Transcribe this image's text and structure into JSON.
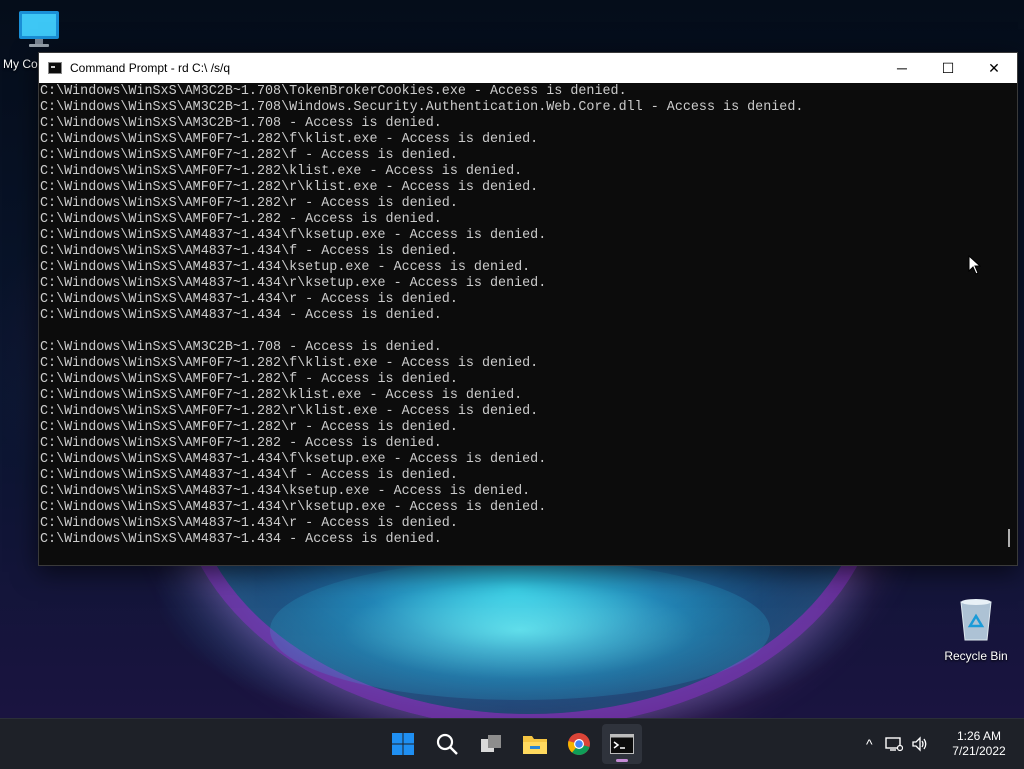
{
  "desktop": {
    "icons": [
      {
        "label": "My Computer"
      },
      {
        "label": "Recycle Bin"
      }
    ]
  },
  "window": {
    "title": "Command Prompt - rd  C:\\ /s/q",
    "controls": {
      "minimize": "─",
      "maximize": "☐",
      "close": "✕"
    }
  },
  "console": {
    "lines": [
      "C:\\Windows\\WinSxS\\AM3C2B~1.708\\TokenBrokerCookies.exe - Access is denied.",
      "C:\\Windows\\WinSxS\\AM3C2B~1.708\\Windows.Security.Authentication.Web.Core.dll - Access is denied.",
      "C:\\Windows\\WinSxS\\AM3C2B~1.708 - Access is denied.",
      "C:\\Windows\\WinSxS\\AMF0F7~1.282\\f\\klist.exe - Access is denied.",
      "C:\\Windows\\WinSxS\\AMF0F7~1.282\\f - Access is denied.",
      "C:\\Windows\\WinSxS\\AMF0F7~1.282\\klist.exe - Access is denied.",
      "C:\\Windows\\WinSxS\\AMF0F7~1.282\\r\\klist.exe - Access is denied.",
      "C:\\Windows\\WinSxS\\AMF0F7~1.282\\r - Access is denied.",
      "C:\\Windows\\WinSxS\\AMF0F7~1.282 - Access is denied.",
      "C:\\Windows\\WinSxS\\AM4837~1.434\\f\\ksetup.exe - Access is denied.",
      "C:\\Windows\\WinSxS\\AM4837~1.434\\f - Access is denied.",
      "C:\\Windows\\WinSxS\\AM4837~1.434\\ksetup.exe - Access is denied.",
      "C:\\Windows\\WinSxS\\AM4837~1.434\\r\\ksetup.exe - Access is denied.",
      "C:\\Windows\\WinSxS\\AM4837~1.434\\r - Access is denied.",
      "C:\\Windows\\WinSxS\\AM4837~1.434 - Access is denied.",
      "",
      "C:\\Windows\\WinSxS\\AM3C2B~1.708 - Access is denied.",
      "C:\\Windows\\WinSxS\\AMF0F7~1.282\\f\\klist.exe - Access is denied.",
      "C:\\Windows\\WinSxS\\AMF0F7~1.282\\f - Access is denied.",
      "C:\\Windows\\WinSxS\\AMF0F7~1.282\\klist.exe - Access is denied.",
      "C:\\Windows\\WinSxS\\AMF0F7~1.282\\r\\klist.exe - Access is denied.",
      "C:\\Windows\\WinSxS\\AMF0F7~1.282\\r - Access is denied.",
      "C:\\Windows\\WinSxS\\AMF0F7~1.282 - Access is denied.",
      "C:\\Windows\\WinSxS\\AM4837~1.434\\f\\ksetup.exe - Access is denied.",
      "C:\\Windows\\WinSxS\\AM4837~1.434\\f - Access is denied.",
      "C:\\Windows\\WinSxS\\AM4837~1.434\\ksetup.exe - Access is denied.",
      "C:\\Windows\\WinSxS\\AM4837~1.434\\r\\ksetup.exe - Access is denied.",
      "C:\\Windows\\WinSxS\\AM4837~1.434\\r - Access is denied.",
      "C:\\Windows\\WinSxS\\AM4837~1.434 - Access is denied."
    ]
  },
  "taskbar": {
    "apps": [
      {
        "icon": "windows-start-icon"
      },
      {
        "icon": "search-icon"
      },
      {
        "icon": "task-view-icon"
      },
      {
        "icon": "file-explorer-icon"
      },
      {
        "icon": "chrome-icon"
      },
      {
        "icon": "command-prompt-icon"
      }
    ],
    "clock": {
      "time": "1:26 AM",
      "date": "7/21/2022"
    },
    "tray": {
      "chevron": "^"
    }
  },
  "colors": {
    "console_bg": "#0c0c0c",
    "console_text": "#cccccc",
    "taskbar_bg": "#1e2128",
    "start_blue": "#1f8ff2"
  }
}
